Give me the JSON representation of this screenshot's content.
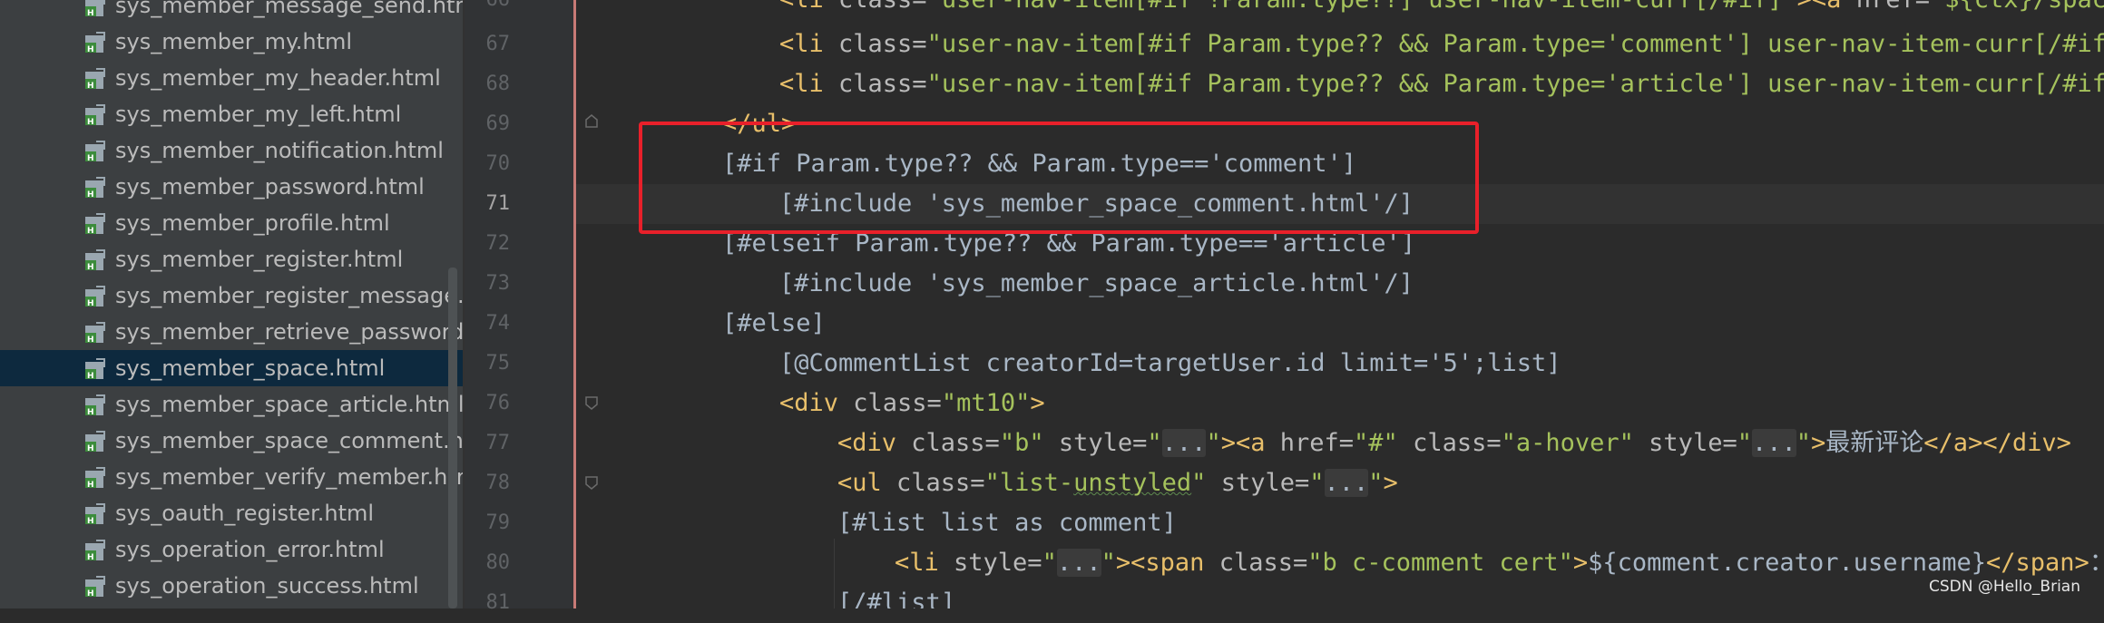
{
  "tree": {
    "selected_index": 10,
    "files": [
      "sys_member_message_send.html",
      "sys_member_my.html",
      "sys_member_my_header.html",
      "sys_member_my_left.html",
      "sys_member_notification.html",
      "sys_member_password.html",
      "sys_member_profile.html",
      "sys_member_register.html",
      "sys_member_register_message.ht",
      "sys_member_retrieve_password.h",
      "sys_member_space.html",
      "sys_member_space_article.html",
      "sys_member_space_comment.htm",
      "sys_member_verify_member.html",
      "sys_oauth_register.html",
      "sys_operation_error.html",
      "sys_operation_success.html"
    ]
  },
  "editor": {
    "current_line": "71",
    "line_numbers": [
      "66",
      "67",
      "68",
      "69",
      "70",
      "71",
      "72",
      "73",
      "74",
      "75",
      "76",
      "77",
      "78",
      "79",
      "80",
      "81"
    ],
    "code": {
      "l66": {
        "a": "<li ",
        "b": "class=",
        "c": "\"user-nav-item[#if !Param.type??] user-nav-item-curr[/#if]\"",
        "d": "><a ",
        "e": "href=",
        "f": "\"${ctx}/space/"
      },
      "l67": {
        "a": "<li ",
        "b": "class=",
        "c": "\"user-nav-item[#if Param.type?? && Param.type='comment'] user-nav-item-curr[/#if]"
      },
      "l68": {
        "a": "<li ",
        "b": "class=",
        "c": "\"user-nav-item[#if Param.type?? && Param.type='article'] user-nav-item-curr[/#if]"
      },
      "l69": {
        "a": "</ul>"
      },
      "l70": {
        "a": "[#if Param.type?? && Param.type=='comment']"
      },
      "l71": {
        "a": "[#include 'sys_member_space_comment.html'/]"
      },
      "l72": {
        "a": "[#elseif Param.type?? && Param.type=='article']"
      },
      "l73": {
        "a": "[#include 'sys_member_space_article.html'/]"
      },
      "l74": {
        "a": "[#else]"
      },
      "l75": {
        "a": "[@CommentList creatorId=targetUser.id limit='5';list]"
      },
      "l76": {
        "a": "<div ",
        "b": "class=",
        "c": "\"mt10\"",
        "d": ">"
      },
      "l77": {
        "a": "<div ",
        "b": "class=",
        "c": "\"b\" ",
        "d": "style=",
        "e": "\"",
        "f": "...",
        "g": "\"",
        "h": "><a ",
        "i": "href=",
        "j": "\"#\" ",
        "k": "class=",
        "l": "\"a-hover\" ",
        "m": "style=",
        "n": "\"",
        "o": "...",
        "p": "\"",
        "q": ">",
        "r": "最新评论",
        "s": "</a></div>"
      },
      "l78": {
        "a": "<ul ",
        "b": "class=",
        "c": "\"list-",
        "d": "unstyled",
        "e": "\" ",
        "f": "style=",
        "g": "\"",
        "h": "...",
        "i": "\"",
        "j": ">"
      },
      "l79": {
        "a": "[#list list as comment]"
      },
      "l80": {
        "a": "<li ",
        "b": "style=",
        "c": "\"",
        "d": "...",
        "e": "\"",
        "f": "><span ",
        "g": "class=",
        "h": "\"b c-comment cert\"",
        "i": ">",
        "j": "${comment.creator.username}",
        "k": "</span>",
        "l": "：<"
      },
      "l81": {
        "a": "[/#list]"
      }
    }
  },
  "watermark": "CSDN @Hello_Brian",
  "colors": {
    "highlight_box": "#e8202a",
    "tag": "#e8bf6a",
    "string": "#a5c25c",
    "text": "#a9b7c6",
    "selection": "#0d293e"
  }
}
